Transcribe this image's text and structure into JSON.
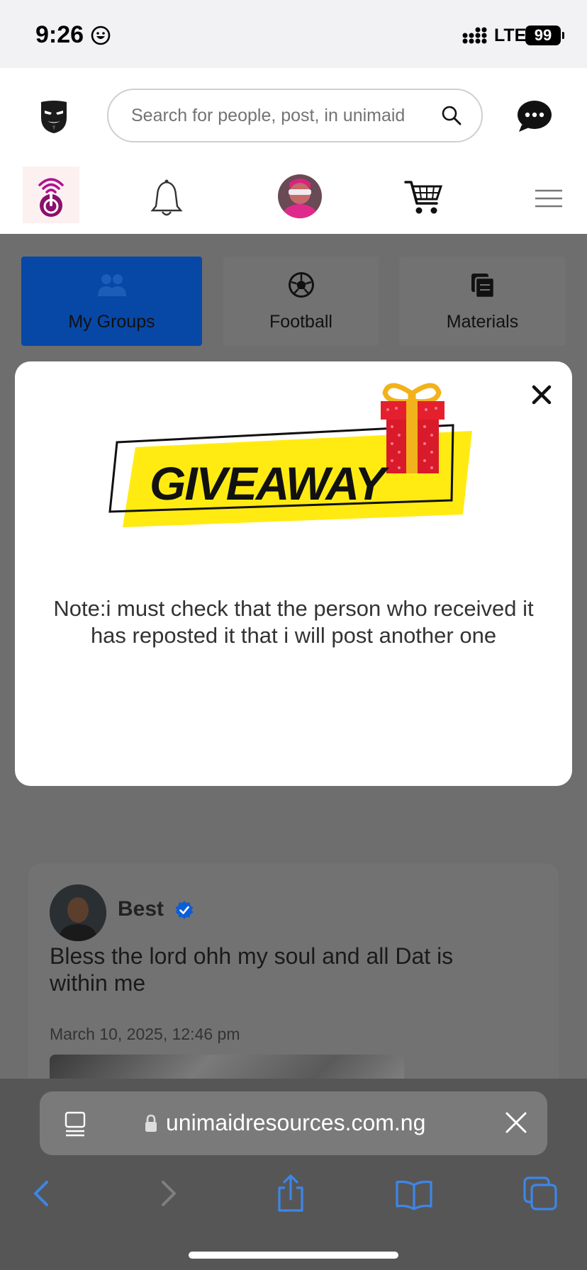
{
  "status_bar": {
    "time": "9:26",
    "network": "LTE",
    "battery": "99"
  },
  "header": {
    "search_placeholder": "Search for people, post, in unimaid",
    "nav": [
      "live-icon",
      "bell-icon",
      "profile-avatar",
      "cart-icon",
      "menu-icon"
    ]
  },
  "tabs": [
    {
      "label": "My Groups",
      "icon": "groups-icon",
      "active": true
    },
    {
      "label": "Football",
      "icon": "football-icon",
      "active": false
    },
    {
      "label": "Materials",
      "icon": "materials-icon",
      "active": false
    }
  ],
  "modal": {
    "banner_text": "GIVEAWAY",
    "note": "Note:i must check that the person who received it has reposted it that i will post another one"
  },
  "post": {
    "author": "Best",
    "text": "Bless the lord ohh my soul and all Dat is within me",
    "date": "March 10, 2025, 12:46 pm"
  },
  "browser": {
    "url": "unimaidresources.com.ng"
  },
  "colors": {
    "accent_blue": "#0747a6",
    "overlay": "#6e6e6e",
    "giveaway_yellow": "#ffeb12",
    "gift_red": "#e4202f",
    "live_purple": "#8a0f6e",
    "safari_blue": "#3d86e8"
  }
}
